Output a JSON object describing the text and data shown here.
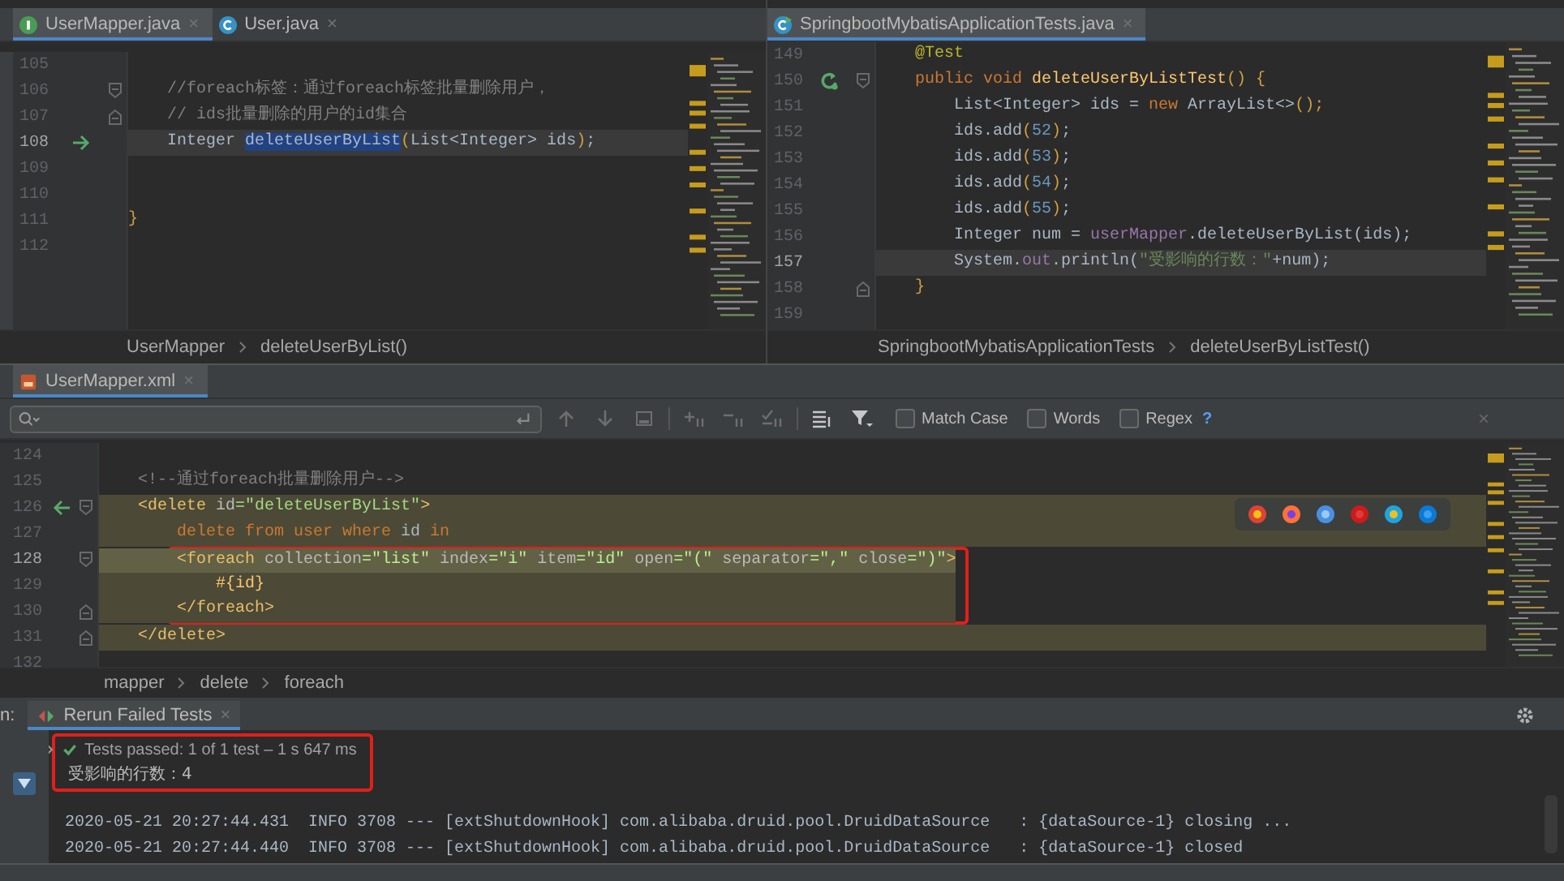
{
  "editors": [
    {
      "tabs": [
        {
          "label": "UserMapper.java",
          "kind": "interface",
          "close": "×",
          "selected": true
        },
        {
          "label": "User.java",
          "kind": "class",
          "close": "×",
          "selected": false
        }
      ],
      "lines": [
        {
          "number": "105"
        },
        {
          "number": "106",
          "fold_marker": {
            "kind": "open"
          },
          "tokens": [
            {
              "kind": "comment",
              "text": "    //foreach标签：通过foreach标签批量删除用户，"
            }
          ]
        },
        {
          "number": "107",
          "fold_marker": {
            "kind": "close"
          },
          "tokens": [
            {
              "kind": "comment",
              "text": "    // ids批量删除的用户的id集合"
            }
          ]
        },
        {
          "number": "108",
          "current": true,
          "gutter_icon": {
            "kind": "arrow-right"
          },
          "tokens": [
            {
              "kind": "plain",
              "text": "    Integer "
            },
            {
              "kind": "selection",
              "text": "deleteUserByList"
            },
            {
              "kind": "brace",
              "text": "("
            },
            {
              "kind": "plain",
              "text": "List<Integer> ids"
            },
            {
              "kind": "brace",
              "text": ")"
            },
            {
              "kind": "plain",
              "text": ";"
            }
          ]
        },
        {
          "number": "109"
        },
        {
          "number": "110"
        },
        {
          "number": "111",
          "tokens": [
            {
              "kind": "brace",
              "text": "}"
            }
          ]
        },
        {
          "number": "112"
        }
      ],
      "breadcrumbs": [
        "UserMapper",
        "deleteUserByList()"
      ]
    },
    {
      "tabs": [
        {
          "label": "SpringbootMybatisApplicationTests.java",
          "kind": "test-class",
          "close": "×",
          "selected": true
        }
      ],
      "lines": [
        {
          "number": "149",
          "tokens": [
            {
              "kind": "annotation",
              "text": "    @Test"
            }
          ]
        },
        {
          "number": "150",
          "gutter_icon": {
            "kind": "run"
          },
          "fold_marker": {
            "kind": "open"
          },
          "tokens": [
            {
              "kind": "keyword",
              "text": "    public void "
            },
            {
              "kind": "method",
              "text": "deleteUserByListTest"
            },
            {
              "kind": "brace",
              "text": "() {"
            }
          ]
        },
        {
          "number": "151",
          "tokens": [
            {
              "kind": "plain",
              "text": "        List<Integer> ids = "
            },
            {
              "kind": "keyword",
              "text": "new"
            },
            {
              "kind": "plain",
              "text": " ArrayList<>"
            },
            {
              "kind": "brace",
              "text": "();"
            }
          ]
        },
        {
          "number": "152",
          "tokens": [
            {
              "kind": "plain",
              "text": "        ids.add"
            },
            {
              "kind": "brace",
              "text": "("
            },
            {
              "kind": "number",
              "text": "52"
            },
            {
              "kind": "brace",
              "text": ")"
            },
            {
              "kind": "plain",
              "text": ";"
            }
          ]
        },
        {
          "number": "153",
          "tokens": [
            {
              "kind": "plain",
              "text": "        ids.add"
            },
            {
              "kind": "brace",
              "text": "("
            },
            {
              "kind": "number",
              "text": "53"
            },
            {
              "kind": "brace",
              "text": ")"
            },
            {
              "kind": "plain",
              "text": ";"
            }
          ]
        },
        {
          "number": "154",
          "tokens": [
            {
              "kind": "plain",
              "text": "        ids.add"
            },
            {
              "kind": "brace",
              "text": "("
            },
            {
              "kind": "number",
              "text": "54"
            },
            {
              "kind": "brace",
              "text": ")"
            },
            {
              "kind": "plain",
              "text": ";"
            }
          ]
        },
        {
          "number": "155",
          "tokens": [
            {
              "kind": "plain",
              "text": "        ids.add"
            },
            {
              "kind": "brace",
              "text": "("
            },
            {
              "kind": "number",
              "text": "55"
            },
            {
              "kind": "brace",
              "text": ")"
            },
            {
              "kind": "plain",
              "text": ";"
            }
          ]
        },
        {
          "number": "156",
          "tokens": [
            {
              "kind": "plain",
              "text": "        Integer num = "
            },
            {
              "kind": "field",
              "text": "userMapper"
            },
            {
              "kind": "plain",
              "text": ".deleteUserByList(ids);"
            }
          ]
        },
        {
          "number": "157",
          "current": true,
          "tokens": [
            {
              "kind": "plain",
              "text": "        System."
            },
            {
              "kind": "field",
              "text": "out"
            },
            {
              "kind": "plain",
              "text": ".println("
            },
            {
              "kind": "string",
              "text": "\"受影响的行数：\""
            },
            {
              "kind": "plain",
              "text": "+num);"
            }
          ]
        },
        {
          "number": "158",
          "fold_marker": {
            "kind": "close"
          },
          "tokens": [
            {
              "kind": "brace",
              "text": "    }"
            }
          ]
        },
        {
          "number": "159"
        }
      ],
      "breadcrumbs": [
        "SpringbootMybatisApplicationTests",
        "deleteUserByListTest()"
      ]
    },
    {
      "tabs": [
        {
          "label": "UserMapper.xml",
          "kind": "xml",
          "close": "×",
          "selected": true
        }
      ],
      "find_bar": {
        "options": [
          {
            "label": "Match Case",
            "checked": false
          },
          {
            "label": "Words",
            "checked": false
          },
          {
            "label": "Regex",
            "checked": false
          }
        ],
        "help": "?",
        "close": "×"
      },
      "lines": [
        {
          "number": "124"
        },
        {
          "number": "125",
          "tokens": [
            {
              "kind": "comment",
              "text": "    <!--通过foreach批量删除用户-->"
            }
          ]
        },
        {
          "number": "126",
          "gutter_icon": {
            "kind": "arrow-left"
          },
          "fold_marker": {
            "kind": "open"
          },
          "injected": true,
          "tokens": [
            {
              "kind": "tag",
              "text": "    <delete"
            },
            {
              "kind": "attr",
              "text": " id"
            },
            {
              "kind": "string",
              "text": "=\"deleteUserByList\""
            },
            {
              "kind": "tag",
              "text": ">"
            }
          ]
        },
        {
          "number": "127",
          "injected": true,
          "tokens": [
            {
              "kind": "sql",
              "text": "        delete from user where "
            },
            {
              "kind": "plain",
              "text": "id"
            },
            {
              "kind": "sql",
              "text": " in"
            }
          ]
        },
        {
          "number": "128",
          "current": true,
          "injected": true,
          "boxed": true,
          "fold_marker": {
            "kind": "open"
          },
          "tokens": [
            {
              "kind": "tag",
              "text": "        <foreach"
            },
            {
              "kind": "attr",
              "text": " collection"
            },
            {
              "kind": "string",
              "text": "=\"list\""
            },
            {
              "kind": "attr",
              "text": " index"
            },
            {
              "kind": "string",
              "text": "=\"i\""
            },
            {
              "kind": "attr",
              "text": " item"
            },
            {
              "kind": "string",
              "text": "=\"id\""
            },
            {
              "kind": "attr",
              "text": " open"
            },
            {
              "kind": "string",
              "text": "=\"(\""
            },
            {
              "kind": "attr",
              "text": " separator"
            },
            {
              "kind": "string",
              "text": "=\",\""
            },
            {
              "kind": "attr",
              "text": " close"
            },
            {
              "kind": "string",
              "text": "=\")\""
            },
            {
              "kind": "tag",
              "text": ">"
            }
          ]
        },
        {
          "number": "129",
          "injected": true,
          "boxed": true,
          "tokens": [
            {
              "kind": "method",
              "text": "            #{id}"
            }
          ]
        },
        {
          "number": "130",
          "injected": true,
          "boxed": true,
          "fold_marker": {
            "kind": "close"
          },
          "tokens": [
            {
              "kind": "tag",
              "text": "        </foreach>"
            }
          ]
        },
        {
          "number": "131",
          "injected": true,
          "fold_marker": {
            "kind": "close"
          },
          "tokens": [
            {
              "kind": "tag",
              "text": "    </delete>"
            }
          ]
        },
        {
          "number": "132"
        }
      ],
      "breadcrumbs": [
        "mapper",
        "delete",
        "foreach"
      ]
    }
  ],
  "run_panel": {
    "label": "n:",
    "tabs": [
      {
        "label": "Rerun Failed Tests",
        "close": "×",
        "selected": true
      }
    ],
    "results": [
      {
        "kind": "status",
        "text": "Tests passed: 1 of 1 test – 1 s 647 ms",
        "boxed": true
      },
      {
        "kind": "stdout",
        "text": "受影响的行数：4",
        "boxed": true
      },
      {
        "kind": "log",
        "text": "2020-05-21 20:27:44.431  INFO 3708 --- [extShutdownHook] com.alibaba.druid.pool.DruidDataSource   : {dataSource-1} closing ...",
        "boxed": false
      },
      {
        "kind": "log",
        "text": "2020-05-21 20:27:44.440  INFO 3708 --- [extShutdownHook] com.alibaba.druid.pool.DruidDataSource   : {dataSource-1} closed",
        "boxed": false
      }
    ]
  }
}
